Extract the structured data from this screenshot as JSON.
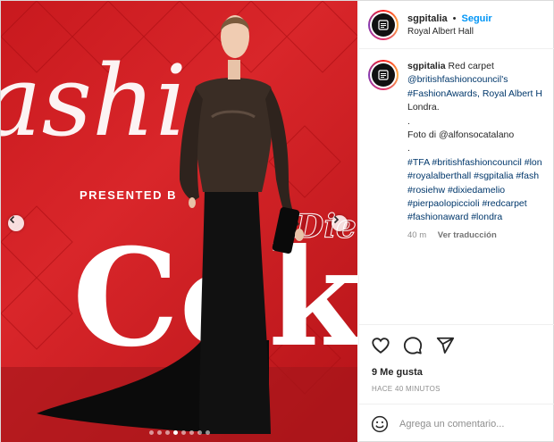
{
  "post": {
    "username": "sgpitalia",
    "separator": "•",
    "follow_label": "Seguir",
    "location": "Royal Albert Hall"
  },
  "caption": {
    "username": "sgpitalia",
    "lines": [
      "Red carpet",
      "@britishfashioncouncil's",
      "#FashionAwards, Royal Albert H",
      "Londra.",
      ".",
      "Foto di @alfonsocatalano",
      ".",
      "#TFA #britishfashioncouncil #lon",
      "#royalalberthall #sgpitalia #fash",
      "#rosiehw #dixiedamelio",
      "#pierpaolopiccioli #redcarpet",
      "#fashionaward #londra"
    ],
    "age": "40 m",
    "translate_label": "Ver traducción"
  },
  "photo": {
    "backdrop_text_top": "ashio",
    "presented_by": "PRESENTED B",
    "brand_text": "Coke",
    "script_text": "Diet"
  },
  "stats": {
    "likes": "9 Me gusta",
    "time": "HACE 40 MINUTOS"
  },
  "comment": {
    "placeholder": "Agrega un comentario..."
  },
  "carousel": {
    "count": 8,
    "active": 3
  },
  "colors": {
    "accent": "#0095f6",
    "backdrop": "#c8191e"
  }
}
